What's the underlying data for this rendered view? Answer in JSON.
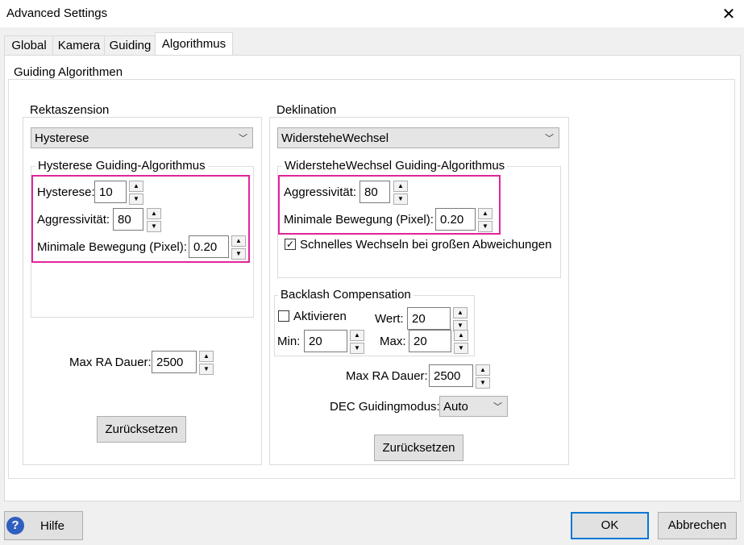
{
  "window": {
    "title": "Advanced Settings",
    "close_glyph": "✕"
  },
  "tabs": [
    "Global",
    "Kamera",
    "Guiding",
    "Algorithmus"
  ],
  "active_tab": "Algorithmus",
  "main_group": {
    "legend": "Guiding Algorithmen"
  },
  "ra": {
    "legend": "Rektaszension",
    "algorithm_select": "Hysterese",
    "subgroup_legend": "Hysterese Guiding-Algorithmus",
    "hysterese_label": "Hysterese:",
    "hysterese_value": "10",
    "aggr_label": "Aggressivität:",
    "aggr_value": "80",
    "minmove_label": "Minimale Bewegung (Pixel):",
    "minmove_value": "0.20",
    "maxdur_label": "Max RA Dauer:",
    "maxdur_value": "2500",
    "reset_label": "Zurücksetzen"
  },
  "dec": {
    "legend": "Deklination",
    "algorithm_select": "WidersteheWechsel",
    "subgroup_legend": "WidersteheWechsel Guiding-Algorithmus",
    "aggr_label": "Aggressivität:",
    "aggr_value": "80",
    "minmove_label": "Minimale Bewegung (Pixel):",
    "minmove_value": "0.20",
    "fast_switch_label": "Schnelles Wechseln bei großen Abweichungen",
    "fast_switch_checked": true,
    "backlash": {
      "legend": "Backlash Compensation",
      "activate_label": "Aktivieren",
      "activate_checked": false,
      "wert_label": "Wert:",
      "wert_value": "20",
      "min_label": "Min:",
      "min_value": "20",
      "max_label": "Max:",
      "max_value": "20"
    },
    "maxdur_label": "Max RA Dauer:",
    "maxdur_value": "2500",
    "guidemode_label": "DEC Guidingmodus:",
    "guidemode_value": "Auto",
    "reset_label": "Zurücksetzen"
  },
  "footer": {
    "help_label": "Hilfe",
    "ok_label": "OK",
    "cancel_label": "Abbrechen",
    "help_glyph": "?"
  },
  "icons": {
    "spin_up": "▲",
    "spin_down": "▼",
    "dropdown": "﹀",
    "check": "✓"
  },
  "colors": {
    "highlight": "#e1259a",
    "default_button_border": "#0078d7"
  }
}
